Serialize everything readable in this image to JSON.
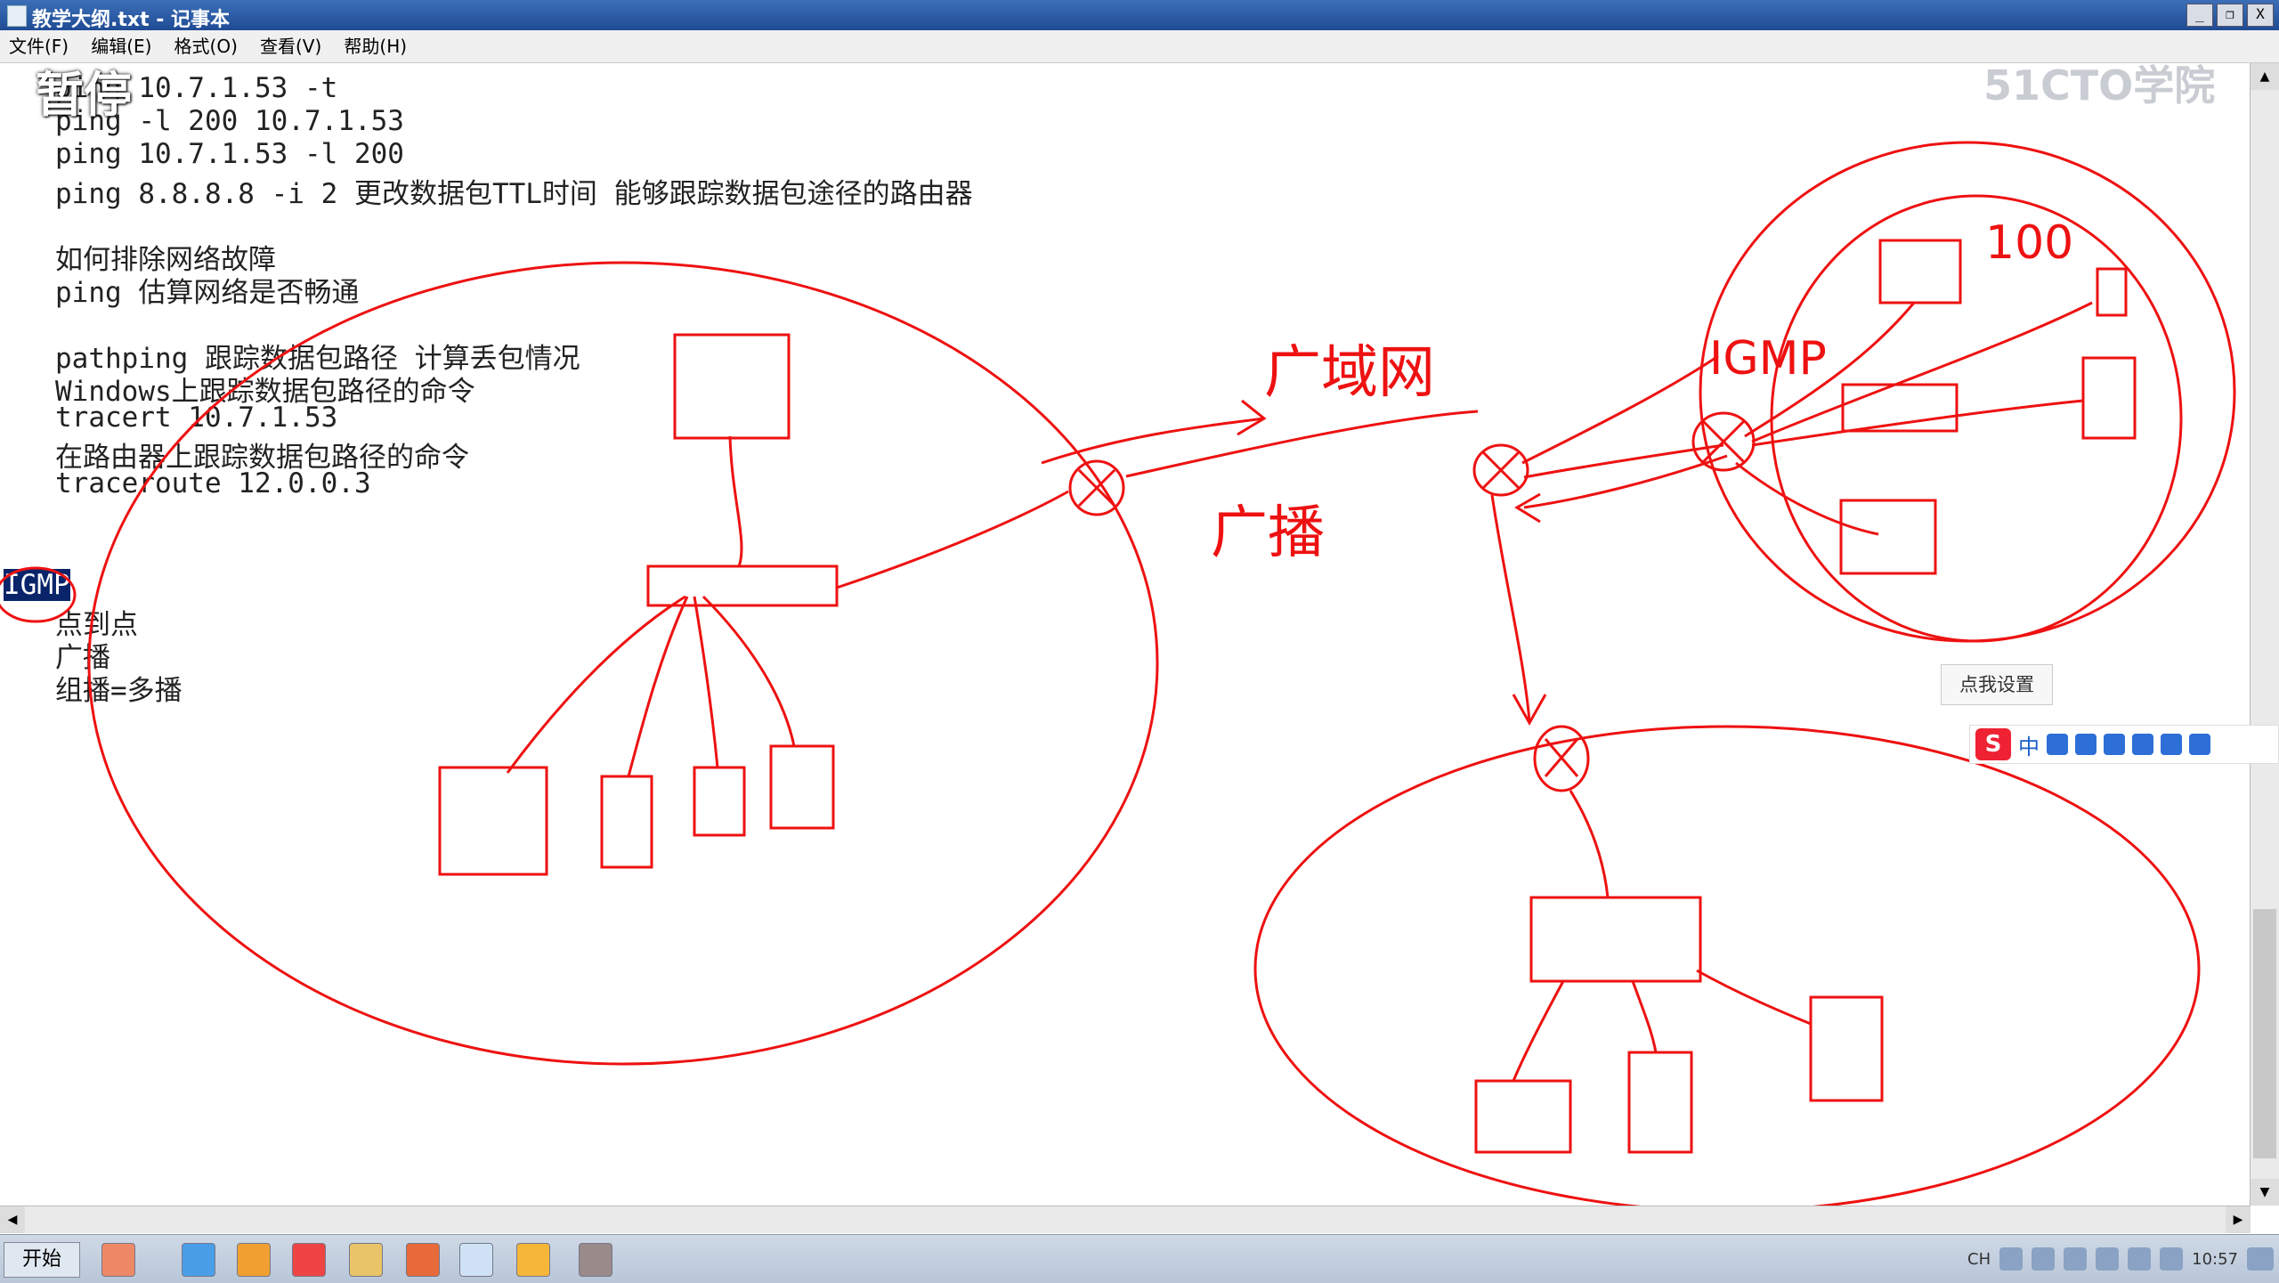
{
  "window": {
    "title": "教学大纲.txt - 记事本",
    "controls": [
      "_",
      "❐",
      "X"
    ]
  },
  "menu": [
    {
      "label": "文件(F)"
    },
    {
      "label": "编辑(E)"
    },
    {
      "label": "格式(O)"
    },
    {
      "label": "查看(V)"
    },
    {
      "label": "帮助(H)"
    }
  ],
  "editor": {
    "lines": [
      "ping 10.7.1.53 -t",
      "ping -l 200 10.7.1.53",
      "ping 10.7.1.53 -l 200",
      "ping 8.8.8.8 -i 2 更改数据包TTL时间 能够跟踪数据包途径的路由器",
      "如何排除网络故障",
      "ping 估算网络是否畅通",
      "pathping 跟踪数据包路径 计算丢包情况",
      "Windows上跟踪数据包路径的命令",
      "tracert 10.7.1.53",
      "在路由器上跟踪数据包路径的命令",
      "traceroute 12.0.0.3",
      "IGMP",
      "点到点",
      "广播",
      "组播=多播"
    ]
  },
  "overlay": {
    "pause_label": "暂停",
    "watermark": "51CTO学院"
  },
  "ime": {
    "tooltip": "点我设置",
    "mode_char": "中",
    "logo_char": "S"
  },
  "taskbar": {
    "start_label": "开始",
    "tray_lang": "CH",
    "clock": "10:57"
  },
  "annotations": {
    "words": [
      "广域网",
      "广播",
      "IGMP",
      "100"
    ],
    "accent_color": "#e11111"
  }
}
